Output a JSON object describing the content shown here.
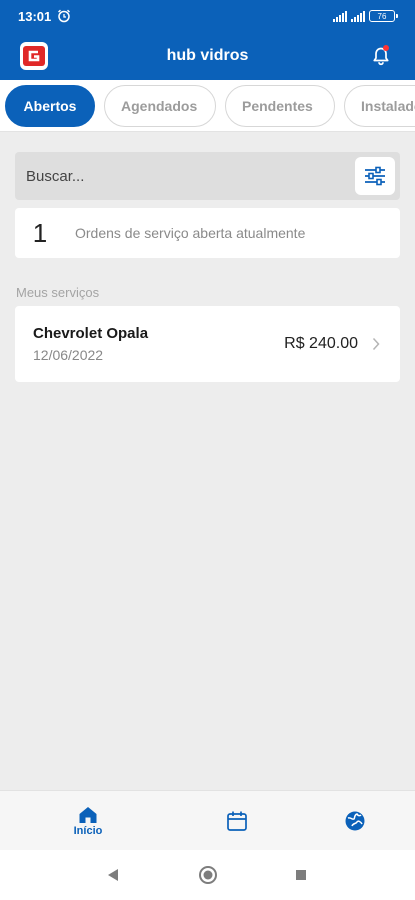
{
  "status_bar": {
    "time": "13:01",
    "battery": "76",
    "alarm_icon": "alarm-clock-icon",
    "signal_icon": "signal-bars-icon"
  },
  "app_bar": {
    "title": "hub vidros",
    "logo_icon": "brand-logo-icon",
    "notification_icon": "bell-icon"
  },
  "tabs": [
    {
      "label": "Abertos",
      "active": true
    },
    {
      "label": "Agendados",
      "active": false
    },
    {
      "label": "Pendentes",
      "active": false
    },
    {
      "label": "Instalados",
      "active": false
    }
  ],
  "search": {
    "placeholder": "Buscar...",
    "filter_icon": "sliders-icon"
  },
  "summary": {
    "count": "1",
    "label": "Ordens de serviço aberta atualmente"
  },
  "services_section": {
    "label": "Meus serviços",
    "items": [
      {
        "title": "Chevrolet Opala",
        "date": "12/06/2022",
        "price": "R$ 240.00"
      }
    ]
  },
  "bottom_nav": {
    "items": [
      {
        "label": "Início",
        "icon": "home-icon",
        "active": true
      },
      {
        "label": "",
        "icon": "calendar-icon",
        "active": false
      },
      {
        "label": "",
        "icon": "globe-icon",
        "active": false
      }
    ]
  },
  "colors": {
    "primary": "#0b61b9",
    "background": "#ededed",
    "notification_dot": "#ff3333"
  }
}
